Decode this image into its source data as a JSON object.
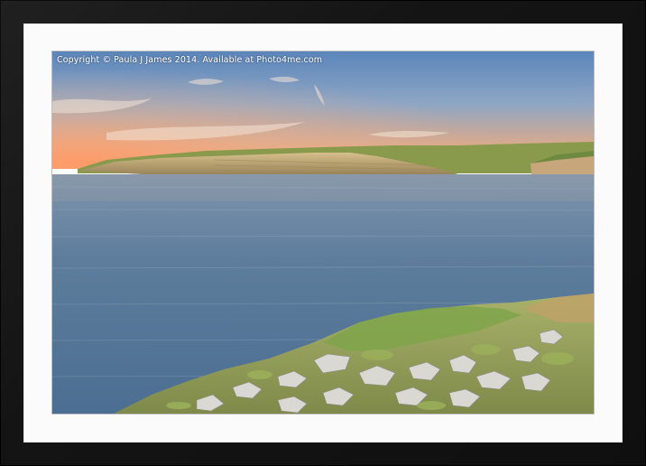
{
  "watermark": {
    "text": "Copyright © Paula J James 2014. Available at Photo4me.com"
  },
  "colors": {
    "frame": "#141414",
    "mount": "#fbfbfb",
    "sky_top": "#5f86b8",
    "sky_glow": "#f0a070",
    "sea": "#5f7f9f",
    "cliff": "#b7a070",
    "grass": "#7f9a45"
  }
}
